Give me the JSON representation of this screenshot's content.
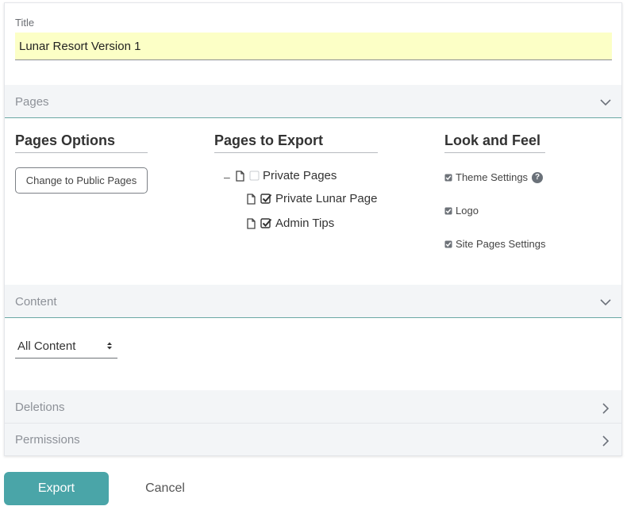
{
  "title_field": {
    "label": "Title",
    "value": "Lunar Resort Version 1"
  },
  "pages_panel": {
    "header": "Pages",
    "pages_options": {
      "heading": "Pages Options",
      "button": "Change to Public Pages"
    },
    "pages_to_export": {
      "heading": "Pages to Export",
      "root": {
        "label": "Private Pages",
        "checked": false
      },
      "children": [
        {
          "label": "Private Lunar Page",
          "checked": true
        },
        {
          "label": "Admin Tips",
          "checked": true
        }
      ]
    },
    "look_and_feel": {
      "heading": "Look and Feel",
      "items": [
        {
          "label": "Theme Settings",
          "checked": true,
          "help": "?"
        },
        {
          "label": "Logo",
          "checked": true
        },
        {
          "label": "Site Pages Settings",
          "checked": true
        }
      ]
    }
  },
  "content_panel": {
    "header": "Content",
    "select_value": "All Content"
  },
  "deletions_panel": {
    "header": "Deletions"
  },
  "permissions_panel": {
    "header": "Permissions"
  },
  "actions": {
    "export": "Export",
    "cancel": "Cancel"
  },
  "colors": {
    "accent": "#4aa5a8",
    "title_bg": "#fcffc6",
    "panel_bg": "#f3f5f7"
  }
}
